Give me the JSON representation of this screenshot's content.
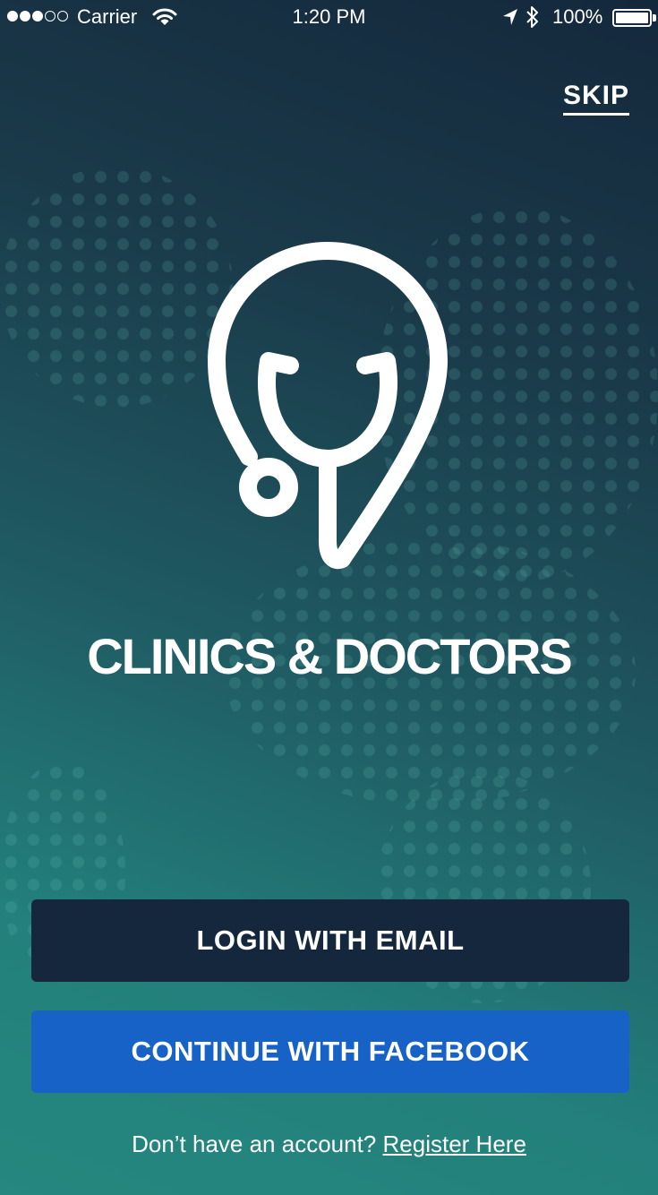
{
  "status_bar": {
    "carrier": "Carrier",
    "time": "1:20 PM",
    "battery": "100%",
    "icons": [
      "signal-dots-icon",
      "wifi-icon",
      "location-arrow-icon",
      "bluetooth-icon",
      "battery-icon"
    ]
  },
  "header": {
    "skip_label": "SKIP"
  },
  "brand": {
    "name": "CLINICS & DOCTORS",
    "logo_icon": "stethoscope-pin-icon"
  },
  "actions": {
    "login_email_label": "LOGIN WITH EMAIL",
    "continue_facebook_label": "CONTINUE WITH FACEBOOK"
  },
  "footer": {
    "prompt": "Don’t have an account?",
    "register_link": "Register Here"
  },
  "colors": {
    "background_top": "#14283c",
    "background_bottom": "#25877f",
    "email_button": "#14273d",
    "facebook_button": "#1762c6",
    "text": "#ffffff"
  }
}
